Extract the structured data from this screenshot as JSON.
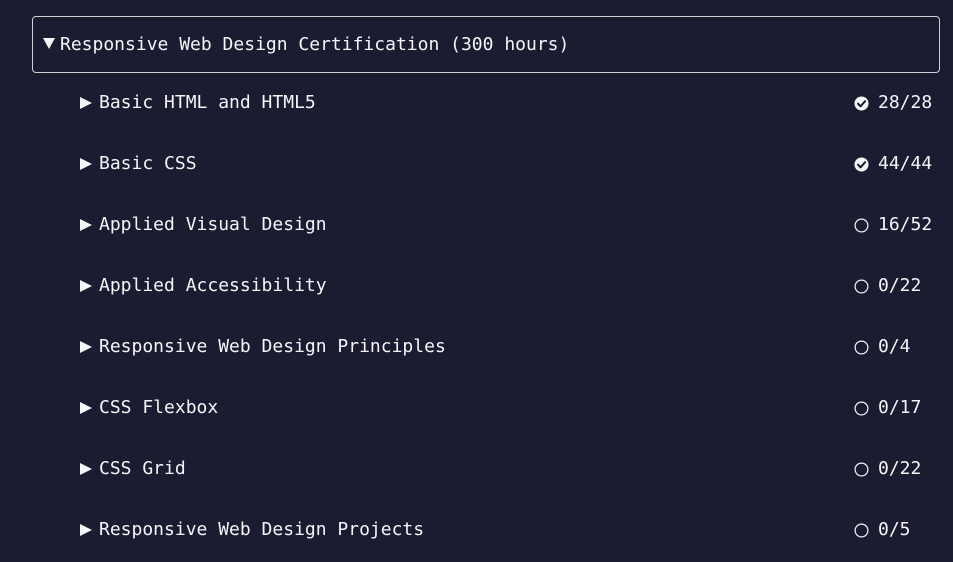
{
  "certification": {
    "title": "Responsive Web Design Certification (300 hours)",
    "expanded": true,
    "icon": "caret-down-icon"
  },
  "blocks": [
    {
      "title": "Basic HTML and HTML5",
      "progress": "28/28",
      "complete": true
    },
    {
      "title": "Basic CSS",
      "progress": "44/44",
      "complete": true
    },
    {
      "title": "Applied Visual Design",
      "progress": "16/52",
      "complete": false
    },
    {
      "title": "Applied Accessibility",
      "progress": "0/22",
      "complete": false
    },
    {
      "title": "Responsive Web Design Principles",
      "progress": "0/4",
      "complete": false
    },
    {
      "title": "CSS Flexbox",
      "progress": "0/17",
      "complete": false
    },
    {
      "title": "CSS Grid",
      "progress": "0/22",
      "complete": false
    },
    {
      "title": "Responsive Web Design Projects",
      "progress": "0/5",
      "complete": false
    }
  ],
  "icons": {
    "collapsed": "caret-right-icon",
    "complete": "check-circle-icon",
    "incomplete": "empty-circle-icon"
  },
  "colors": {
    "background": "#1b1b32",
    "text": "#f5f6f7",
    "border": "#d0d0d5"
  }
}
